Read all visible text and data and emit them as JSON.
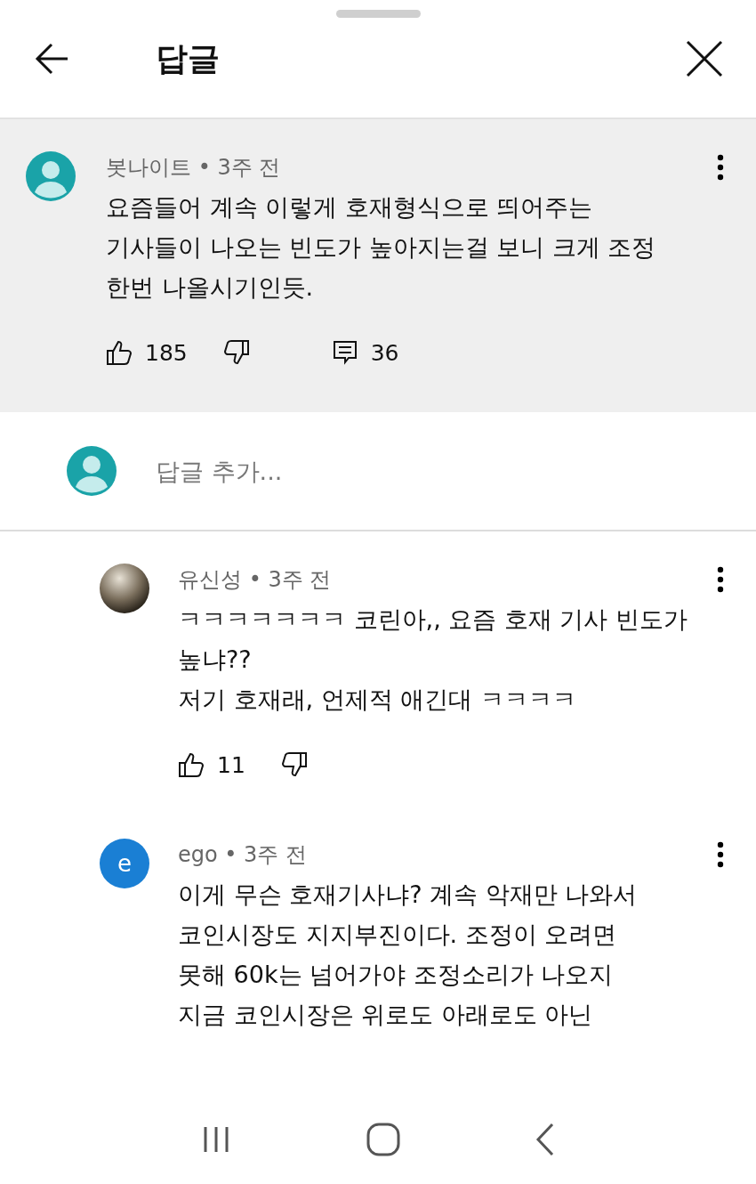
{
  "header": {
    "title": "답글"
  },
  "comment": {
    "avatar": {
      "kind": "default"
    },
    "meta": "봇나이트 • 3주 전",
    "lines": [
      "요즘들어 계속 이렇게 호재형식으로 띄어주는",
      "기사들이 나오는 빈도가 높아지는걸 보니 크게 조정",
      "한번 나올시기인듯."
    ],
    "likes": "185",
    "replies": "36"
  },
  "reply_field": {
    "avatar": {
      "kind": "default"
    },
    "placeholder": "답글 추가..."
  },
  "replies": [
    {
      "avatar": {
        "kind": "picture"
      },
      "meta": "유신성 • 3주 전",
      "lines": [
        "ㅋㅋㅋㅋㅋㅋㅋ 코린아,, 요즘 호재 기사 빈도가",
        "높냐??",
        "저기 호재래, 언제적 애긴대 ㅋㅋㅋㅋ"
      ],
      "likes": "11"
    },
    {
      "avatar": {
        "kind": "letter",
        "letter": "e"
      },
      "meta": "ego • 3주 전",
      "lines": [
        "이게 무슨 호재기사냐? 계속 악재만 나와서",
        "코인시장도 지지부진이다. 조정이 오려면",
        "못해 60k는 넘어가야 조정소리가 나오지",
        "지금 코인시장은 위로도 아래로도 아닌"
      ]
    }
  ]
}
